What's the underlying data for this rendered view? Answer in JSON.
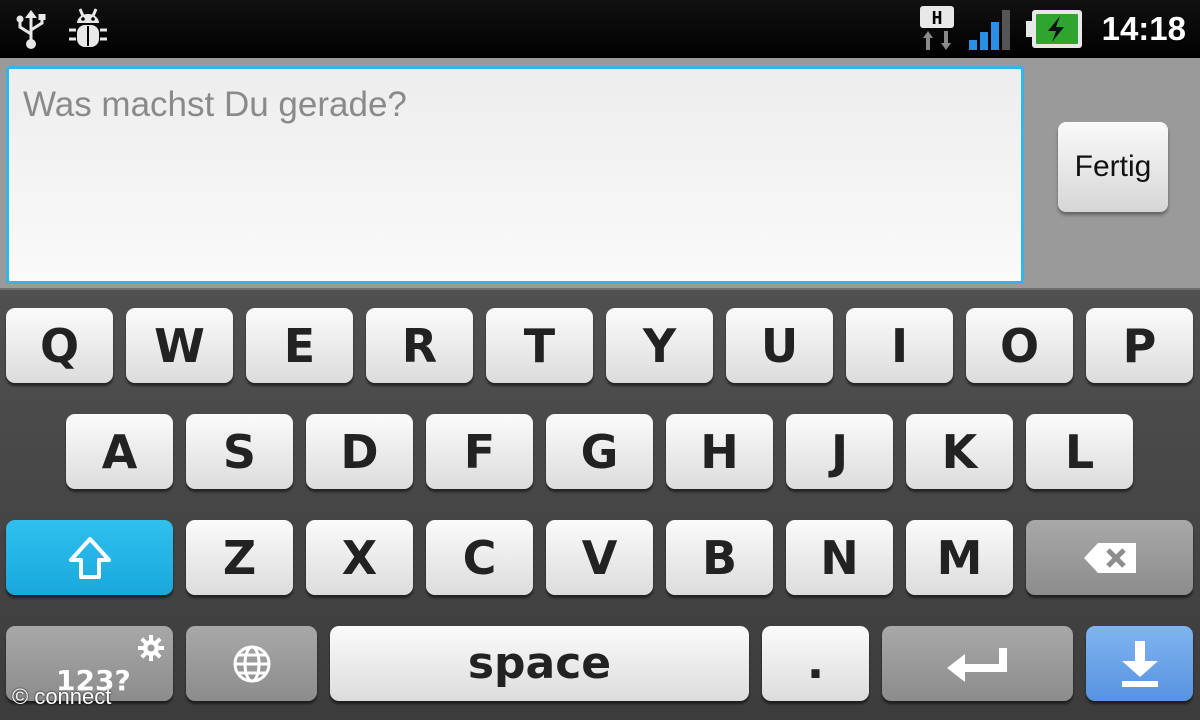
{
  "status_bar": {
    "time": "14:18",
    "network_type": "H",
    "icons": [
      "usb-icon",
      "bug-icon",
      "hspa-icon",
      "signal-icon",
      "battery-charging-icon"
    ]
  },
  "compose": {
    "placeholder": "Was machst Du gerade?",
    "value": "",
    "done_label": "Fertig"
  },
  "keyboard": {
    "row1": [
      "Q",
      "W",
      "E",
      "R",
      "T",
      "Y",
      "U",
      "I",
      "O",
      "P"
    ],
    "row2": [
      "A",
      "S",
      "D",
      "F",
      "G",
      "H",
      "J",
      "K",
      "L"
    ],
    "row3": [
      "Z",
      "X",
      "C",
      "V",
      "B",
      "N",
      "M"
    ],
    "symbols_label": "123?",
    "space_label": "space",
    "period_label": ".",
    "shift_icon": "shift-arrow-icon",
    "backspace_icon": "backspace-icon",
    "globe_icon": "globe-icon",
    "enter_icon": "enter-arrow-icon",
    "hide_icon": "hide-keyboard-icon",
    "settings_icon": "gear-icon"
  },
  "watermark": "© connect",
  "colors": {
    "accent": "#33b5e5",
    "shift_key": "#1aa8dc",
    "hide_key": "#5893e0",
    "battery_green": "#2fa52f"
  }
}
